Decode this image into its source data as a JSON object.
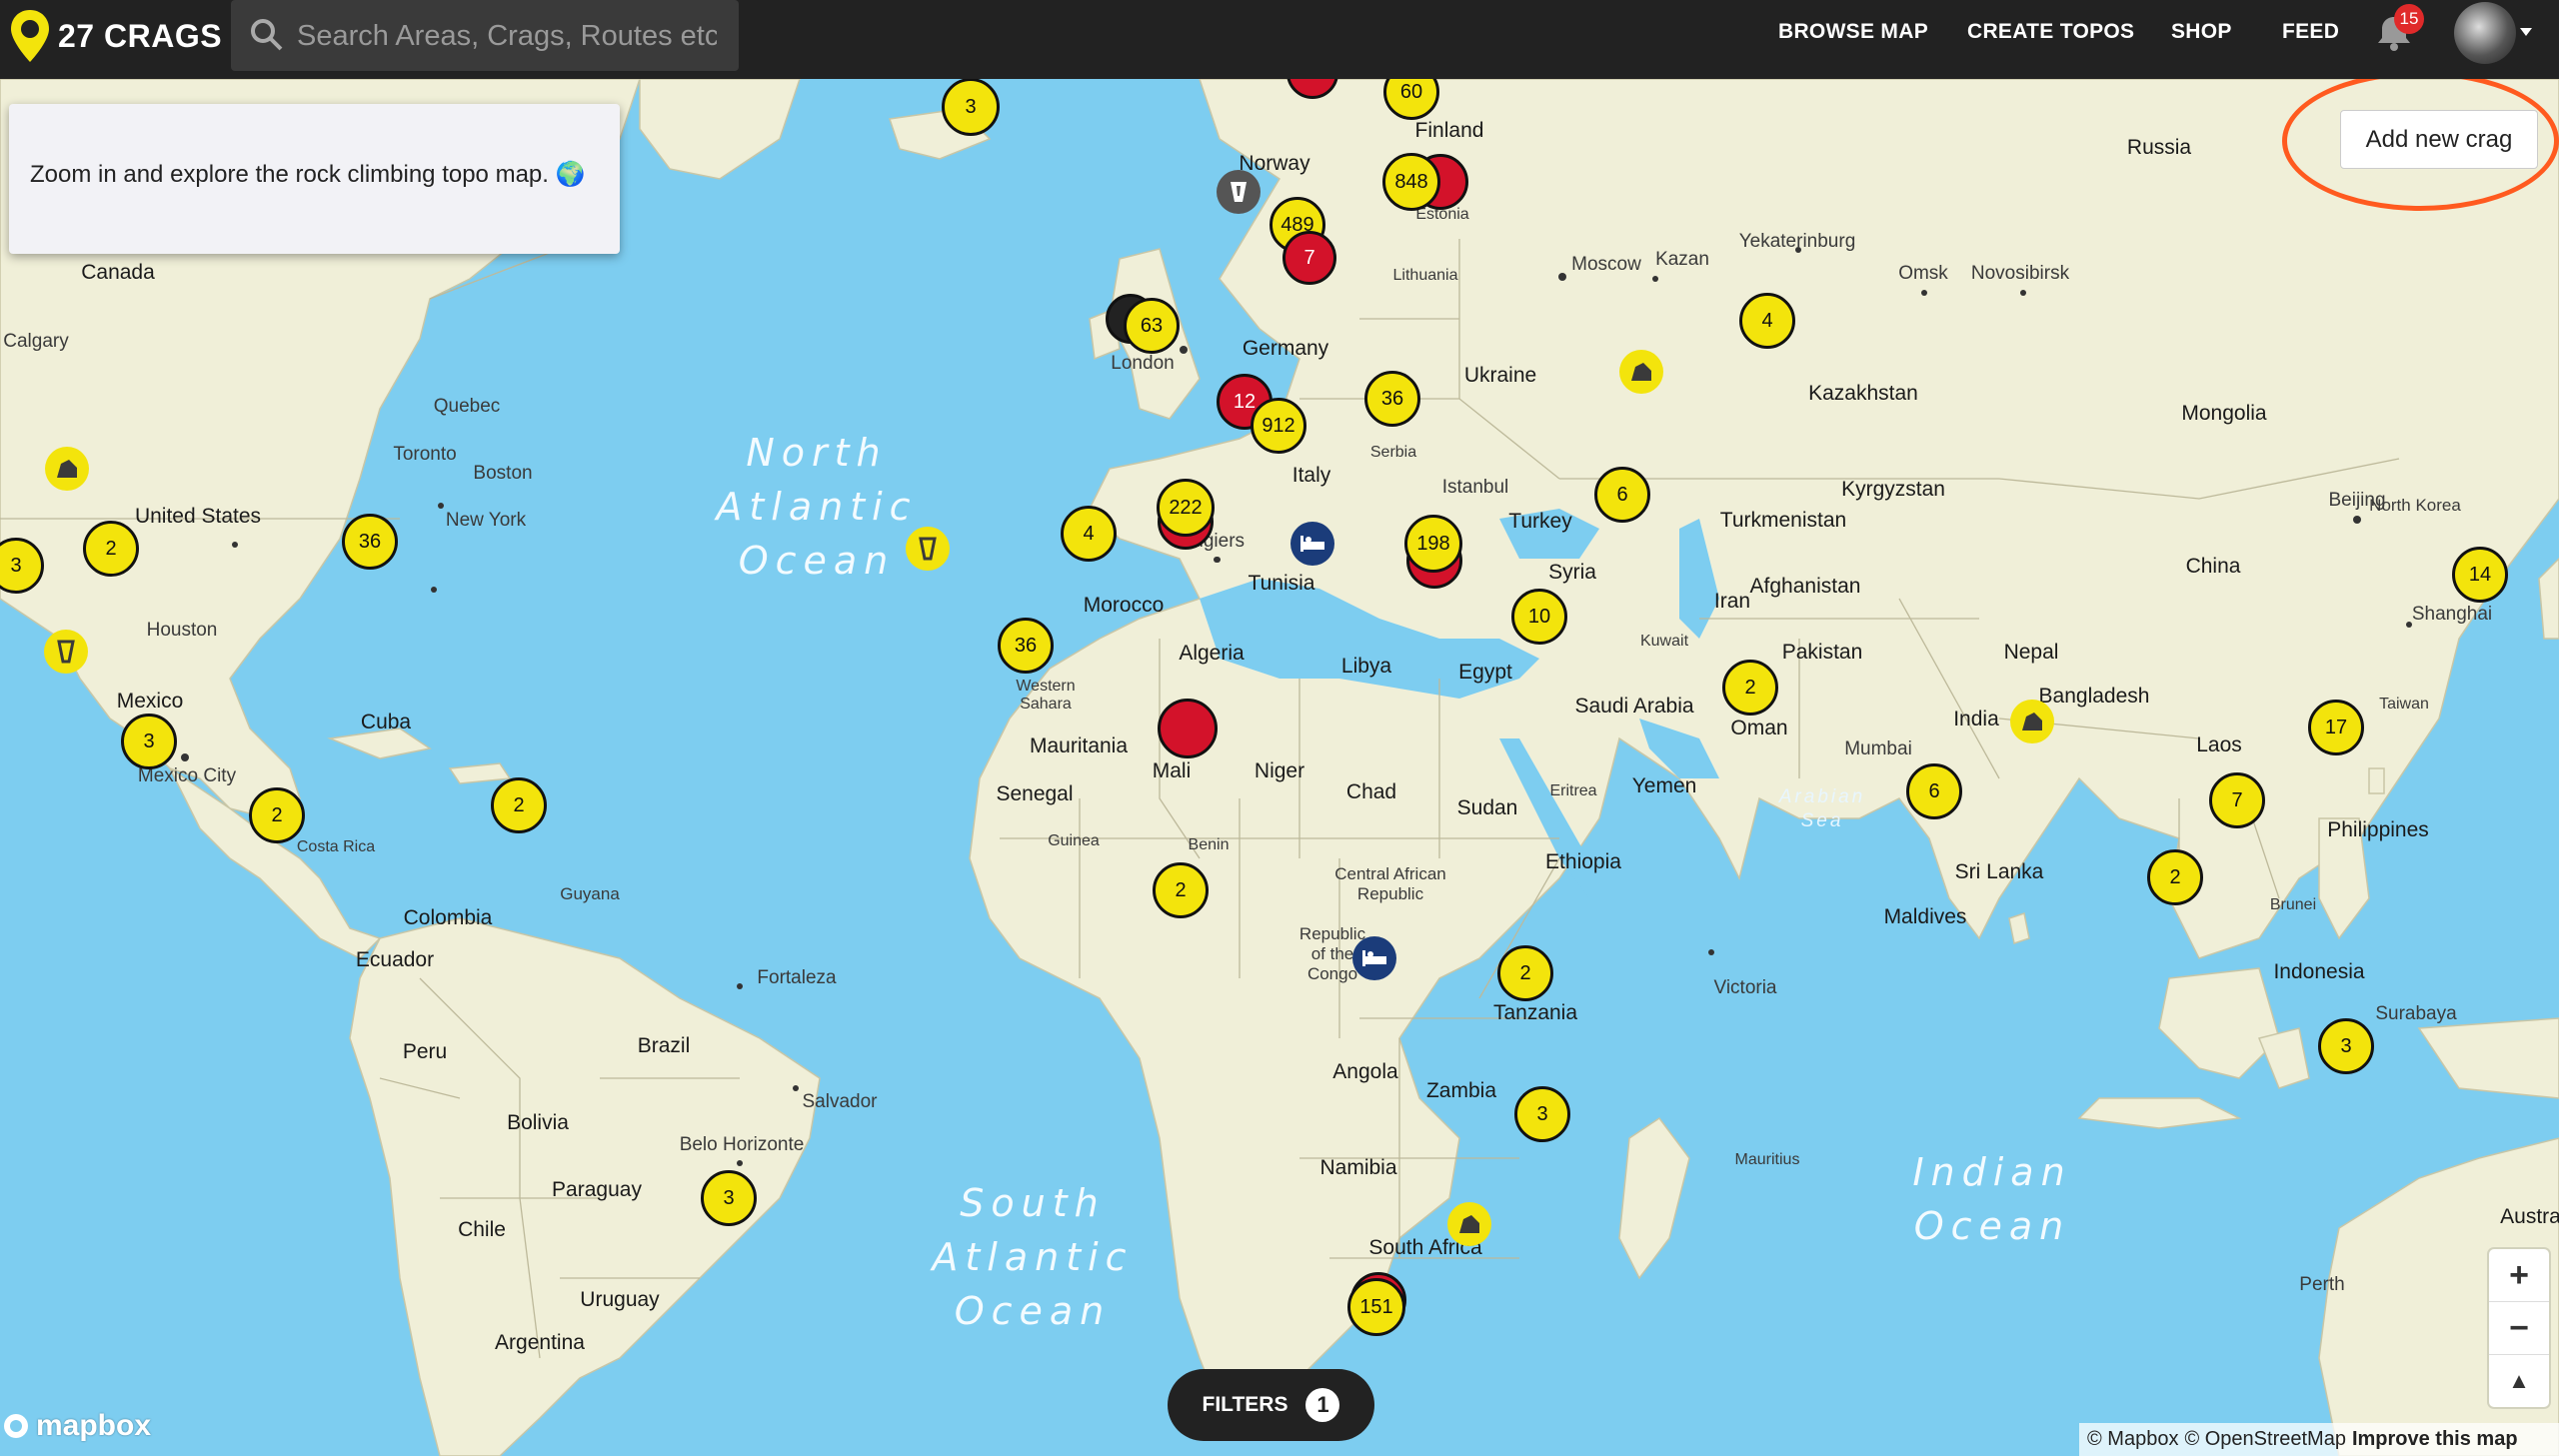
{
  "header": {
    "logo_text": "27 CRAGS",
    "search_placeholder": "Search Areas, Crags, Routes etc.",
    "nav": [
      "BROWSE MAP",
      "CREATE TOPOS",
      "SHOP",
      "FEED"
    ],
    "notification_count": "15"
  },
  "tooltip": {
    "text": "Zoom in and explore the rock climbing topo map. 🌍"
  },
  "add_crag_label": "Add new crag",
  "filters": {
    "label": "FILTERS",
    "count": "1"
  },
  "zoom": {
    "in": "+",
    "out": "−",
    "compass": "▲"
  },
  "mapbox_label": "mapbox",
  "attribution": {
    "mapbox": "© Mapbox",
    "osm": "© OpenStreetMap",
    "improve": "Improve this map"
  },
  "map_labels": {
    "countries": [
      "Canada",
      "United States",
      "Mexico",
      "Cuba",
      "Colombia",
      "Ecuador",
      "Peru",
      "Brazil",
      "Bolivia",
      "Paraguay",
      "Chile",
      "Uruguay",
      "Argentina",
      "Guyana",
      "Norway",
      "Finland",
      "Estonia",
      "Lithuania",
      "Germany",
      "Italy",
      "Ukraine",
      "Serbia",
      "Turkey",
      "Syria",
      "Russia",
      "Kazakhstan",
      "Mongolia",
      "Kyrgyzstan",
      "Turkmenistan",
      "Afghanistan",
      "Iran",
      "Pakistan",
      "Nepal",
      "India",
      "Bangladesh",
      "China",
      "North Korea",
      "Laos",
      "Taiwan",
      "Philippines",
      "Brunei",
      "Indonesia",
      "Sri Lanka",
      "Maldives",
      "Morocco",
      "Western Sahara",
      "Algeria",
      "Libya",
      "Egypt",
      "Mauritania",
      "Mali",
      "Niger",
      "Chad",
      "Sudan",
      "Senegal",
      "Guinea",
      "Benin",
      "Central African Republic",
      "Eritrea",
      "Ethiopia",
      "Saudi Arabia",
      "Yemen",
      "Oman",
      "Kuwait",
      "Tunisia",
      "Republic of the Congo",
      "Tanzania",
      "Angola",
      "Zambia",
      "Namibia",
      "South Africa",
      "Mauritius",
      "Australia"
    ],
    "cities": [
      "Calgary",
      "Quebec",
      "Toronto",
      "Boston",
      "New York",
      "Houston",
      "Mexico City",
      "Costa Rica",
      "Fortaleza",
      "Salvador",
      "Belo Horizonte",
      "London",
      "Istanbul",
      "Algiers",
      "Moscow",
      "Kazan",
      "Yekaterinburg",
      "Omsk",
      "Novosibirsk",
      "Beijing",
      "Shanghai",
      "Mumbai",
      "Surabaya",
      "Victoria",
      "Perth"
    ],
    "oceans": [
      "North Atlantic Ocean",
      "South Atlantic Ocean",
      "Indian Ocean",
      "Arabian Sea"
    ]
  },
  "crag_clusters": [
    "3",
    "60",
    "848",
    "489",
    "7",
    "63",
    "12",
    "912",
    "36",
    "4",
    "222",
    "198",
    "36",
    "10",
    "6",
    "2",
    "4",
    "3",
    "2",
    "36",
    "3",
    "2",
    "2",
    "2",
    "2",
    "3",
    "151",
    "3",
    "6",
    "7",
    "2",
    "17",
    "14",
    "3"
  ],
  "colors": {
    "topbar": "#222222",
    "cluster_yellow": "#f3e40c",
    "cluster_red": "#d3122a",
    "water": "#7dcdf0",
    "land": "#f0efd8",
    "accent_ring": "#ff5a1f"
  }
}
